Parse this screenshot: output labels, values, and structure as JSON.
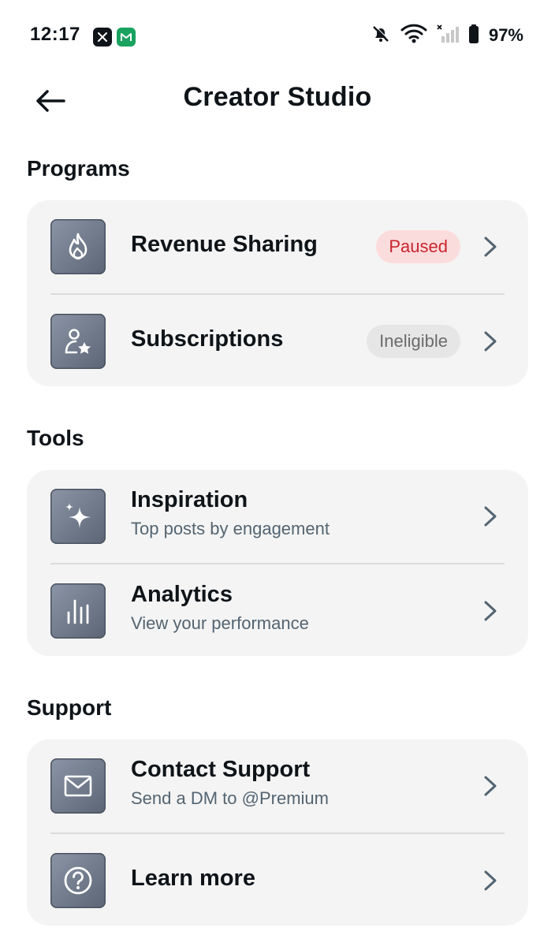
{
  "status_bar": {
    "time": "12:17",
    "battery": "97%",
    "apps": [
      "x-app-icon",
      "mail-app-icon"
    ],
    "indicators": [
      "bell-off-icon",
      "wifi-icon",
      "signal-icon",
      "battery-icon"
    ]
  },
  "header": {
    "title": "Creator Studio",
    "back_icon": "back-arrow-icon"
  },
  "sections": [
    {
      "title": "Programs",
      "items": [
        {
          "label": "Revenue Sharing",
          "icon": "flame-icon",
          "badge": "Paused"
        },
        {
          "label": "Subscriptions",
          "icon": "person-star-icon",
          "badge": "Ineligible"
        }
      ]
    },
    {
      "title": "Tools",
      "items": [
        {
          "label": "Inspiration",
          "subtitle": "Top posts by engagement",
          "icon": "sparkles-icon"
        },
        {
          "label": "Analytics",
          "subtitle": "View your performance",
          "icon": "bar-chart-icon"
        }
      ]
    },
    {
      "title": "Support",
      "items": [
        {
          "label": "Contact Support",
          "subtitle": "Send a DM to @Premium",
          "icon": "envelope-icon"
        },
        {
          "label": "Learn more",
          "icon": "question-icon"
        }
      ]
    }
  ],
  "colors": {
    "card_bg": "#f4f4f4",
    "paused_badge_bg": "#fbdcdc",
    "paused_badge_text": "#c8262f",
    "ineligible_badge_bg": "#e6e6e6",
    "ineligible_badge_text": "#6b6b6b"
  }
}
